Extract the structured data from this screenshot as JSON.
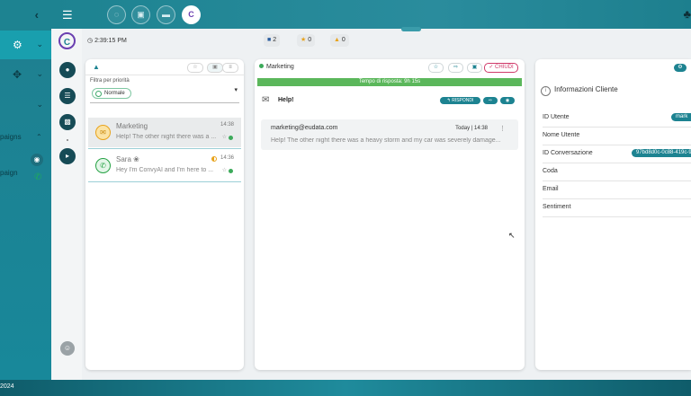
{
  "sidebar": {
    "collapse_icon": "chevron-left-icon",
    "items": [
      {
        "icon": "globe-settings-icon",
        "active": true
      },
      {
        "icon": "move-arrows-icon",
        "active": false
      },
      {
        "icon": "chevron-down-icon",
        "active": false
      }
    ],
    "campaigns_label": "paigns",
    "campaign_item_label": "paign"
  },
  "topbar": {
    "menu_icon": "hamburger-icon",
    "app_letter": "C"
  },
  "infobar": {
    "time": "2:39:15 PM",
    "comments_count": "2",
    "stars_count": "0",
    "warnings_count": "0"
  },
  "conversation_list": {
    "filter_label": "Filtra per priorità",
    "priority_chip": "Normale",
    "items": [
      {
        "name": "Marketing",
        "time": "14:38",
        "preview": "Help! The other night there was a ...",
        "channel": "email",
        "selected": true
      },
      {
        "name": "Sara ❀",
        "time": "14:36",
        "preview": "Hey I'm ConvyAI and I'm here to ...",
        "channel": "whatsapp",
        "selected": false
      }
    ]
  },
  "conversation": {
    "status": "Marketing",
    "close_label": "✓ CHIUDI",
    "progress_text": "Tempo di risposta: 9h 15s",
    "progress_fraction": 1.0,
    "subject": "Help!",
    "reply_label": "↰ RISPONDI",
    "message": {
      "from": "marketing@eudata.com",
      "date": "Today | 14:38",
      "body": "Help! The other night there was a heavy storm and my car was severely damage..."
    }
  },
  "customer_info": {
    "title": "Informazioni Cliente",
    "fields": [
      {
        "label": "ID Utente",
        "value": "mark"
      },
      {
        "label": "Nome Utente",
        "value": ""
      },
      {
        "label": "ID Conversazione",
        "value": "97bd8d0c-0c88-419c-9"
      },
      {
        "label": "Coda",
        "value": ""
      },
      {
        "label": "Email",
        "value": ""
      },
      {
        "label": "Sentiment",
        "value": ""
      }
    ]
  },
  "footer": {
    "year": "2024"
  },
  "colors": {
    "accent": "#1d8391",
    "close": "#d03a6a",
    "online": "#3caa5a"
  }
}
